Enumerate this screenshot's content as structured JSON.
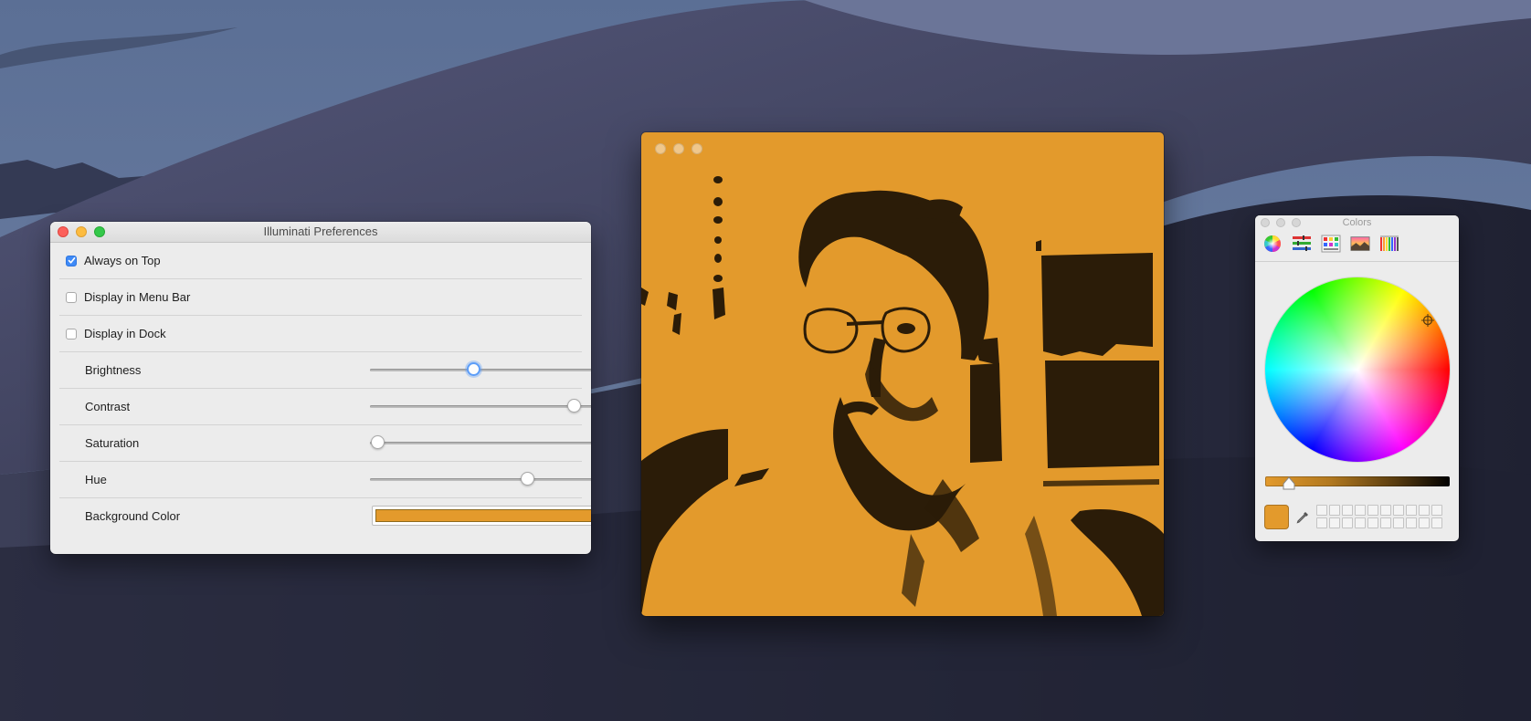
{
  "desktop": {
    "name": "macOS Mojave dunes wallpaper"
  },
  "preferences": {
    "title": "Illuminati Preferences",
    "rows": [
      {
        "type": "checkbox",
        "label": "Always on Top",
        "checked": true
      },
      {
        "type": "checkbox",
        "label": "Display in Menu Bar",
        "checked": false
      },
      {
        "type": "checkbox",
        "label": "Display in Dock",
        "checked": false
      },
      {
        "type": "slider",
        "label": "Brightness",
        "value": 0.4,
        "focused": true
      },
      {
        "type": "slider",
        "label": "Contrast",
        "value": 0.79
      },
      {
        "type": "slider",
        "label": "Saturation",
        "value": 0.03
      },
      {
        "type": "slider",
        "label": "Hue",
        "value": 0.61
      },
      {
        "type": "color",
        "label": "Background Color",
        "color": "#e39a2c"
      }
    ]
  },
  "camera": {
    "background_color": "#e39a2c",
    "shadow_color": "#2b1c08"
  },
  "colors_panel": {
    "title": "Colors",
    "tabs": [
      "color-wheel-icon",
      "sliders-icon",
      "palettes-icon",
      "image-palettes-icon",
      "pencils-icon"
    ],
    "selected_color": "#e39a2c",
    "brightness": 0.13
  }
}
